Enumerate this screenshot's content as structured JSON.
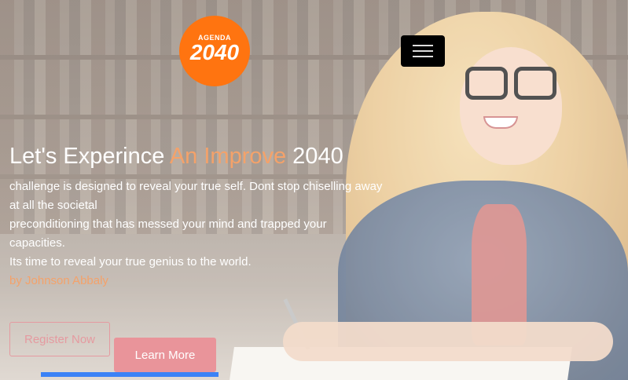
{
  "logo": {
    "top_text": "AGENDA",
    "number": "2040"
  },
  "nav": {
    "menu_icon": "hamburger-icon"
  },
  "hero": {
    "headline_part1": "Let's Experince ",
    "headline_accent": "An Improve",
    "headline_part2": " 2040",
    "desc_line1": "challenge is designed to reveal your true self. Dont stop chiselling away at all the societal",
    "desc_line2": "preconditioning that has messed your mind and trapped your capacities.",
    "desc_line3": "Its time to reveal your true genius to the world.",
    "byline": "by Johnson Abbaly"
  },
  "buttons": {
    "register": "Register Now",
    "learn_more": "Learn More"
  },
  "colors": {
    "accent": "#f4a26a",
    "logo": "#ff7410",
    "button": "#e9949a",
    "progress": "#3b82f6"
  }
}
